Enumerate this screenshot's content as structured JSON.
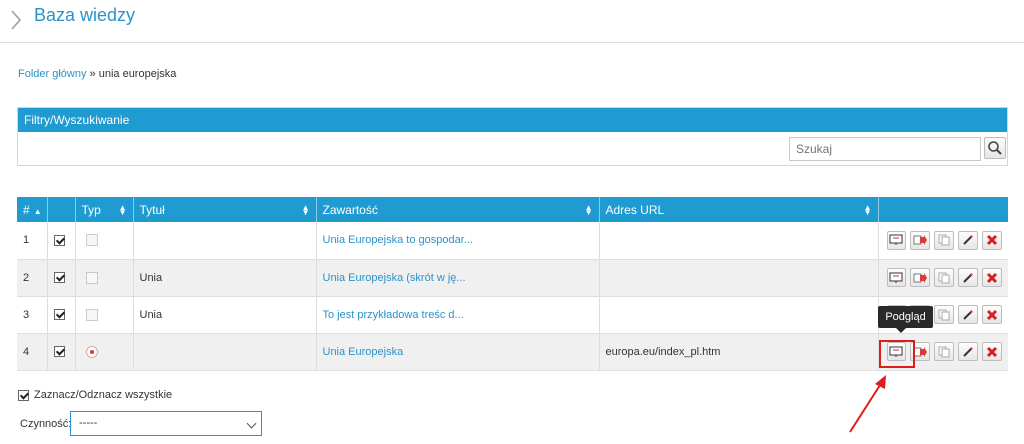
{
  "page": {
    "title": "Baza wiedzy",
    "accent": "#1f9bd1"
  },
  "breadcrumb": {
    "root": "Folder główny",
    "separator": " » ",
    "current": "unia europejska"
  },
  "filters": {
    "header": "Filtry/Wyszukiwanie",
    "search_placeholder": "Szukaj"
  },
  "table": {
    "columns": [
      "#",
      "",
      "Typ",
      "Tytuł",
      "Zawartość",
      "Adres URL",
      ""
    ],
    "rows": [
      {
        "num": "1",
        "checked": true,
        "type": "text-doc-icon",
        "title": "",
        "content": "Unia Europejska to gospodar...",
        "url": ""
      },
      {
        "num": "2",
        "checked": true,
        "type": "text-doc-icon",
        "title": "Unia",
        "content": "Unia Europejska (skrót w ję...",
        "url": ""
      },
      {
        "num": "3",
        "checked": true,
        "type": "text-doc-icon",
        "title": "Unia",
        "content": "To jest przykładowa treśc d...",
        "url": ""
      },
      {
        "num": "4",
        "checked": true,
        "type": "web-link-icon",
        "title": "",
        "content": "Unia Europejska",
        "url": "europa.eu/index_pl.htm"
      }
    ],
    "row_actions": [
      "preview-icon",
      "move-icon",
      "copy-icon",
      "edit-icon",
      "delete-icon"
    ]
  },
  "tooltip": "Podgląd",
  "footer": {
    "select_all_label": "Zaznacz/Odznacz wszystkie",
    "action_label": "Czynność:",
    "action_value": "-----"
  },
  "colors": {
    "annotation": "#e01b1b",
    "link": "#2a94c8"
  }
}
